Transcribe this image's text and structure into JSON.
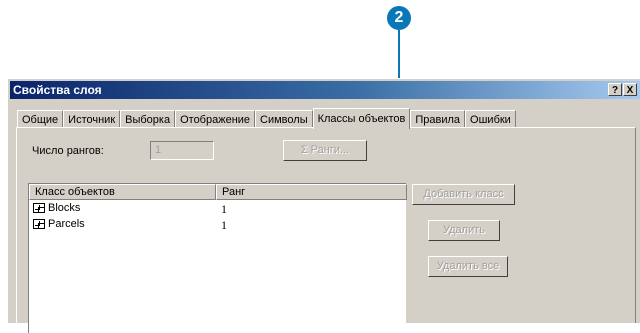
{
  "callout": {
    "number": "2"
  },
  "window": {
    "title": "Свойства слоя",
    "help_button": "?",
    "close_button": "X"
  },
  "tabs": [
    {
      "label": "Общие"
    },
    {
      "label": "Источник"
    },
    {
      "label": "Выборка"
    },
    {
      "label": "Отображение"
    },
    {
      "label": "Символы"
    },
    {
      "label": "Классы объектов",
      "active": true
    },
    {
      "label": "Правила"
    },
    {
      "label": "Ошибки"
    }
  ],
  "panel": {
    "rank_count_label": "Число рангов:",
    "rank_count_value": "1",
    "ranks_button": "Σ Ранги...",
    "list": {
      "columns": [
        "Класс объектов",
        "Ранг"
      ],
      "rows": [
        {
          "name": "Blocks",
          "rank": "1",
          "icon": "feature-class-icon"
        },
        {
          "name": "Parcels",
          "rank": "1",
          "icon": "feature-class-icon"
        }
      ]
    },
    "add_class_button": "Добавить класс",
    "remove_button": "Удалить",
    "remove_all_button": "Удалить все"
  },
  "colors": {
    "callout": "#0a78b8",
    "titlebar_start": "#0a246a",
    "titlebar_end": "#a6caf0",
    "face": "#d4d0c8",
    "disabled_text": "#a0a0a0"
  }
}
